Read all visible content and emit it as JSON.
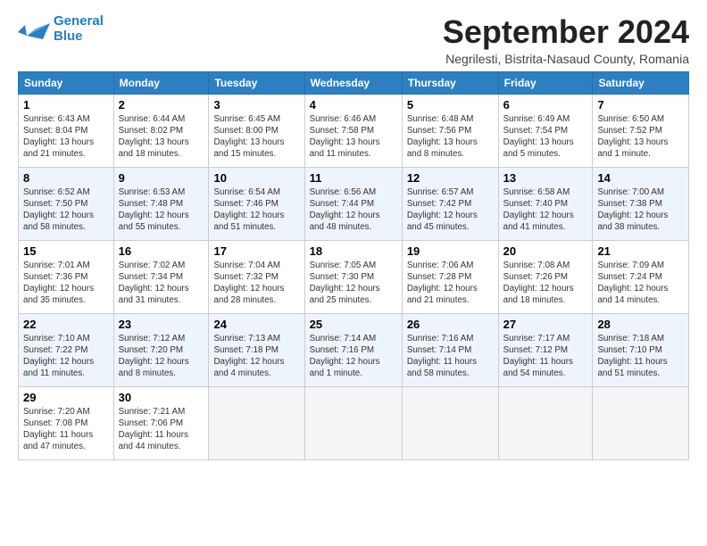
{
  "header": {
    "logo_line1": "General",
    "logo_line2": "Blue",
    "month_title": "September 2024",
    "subtitle": "Negrilesti, Bistrita-Nasaud County, Romania"
  },
  "days_of_week": [
    "Sunday",
    "Monday",
    "Tuesday",
    "Wednesday",
    "Thursday",
    "Friday",
    "Saturday"
  ],
  "weeks": [
    [
      {
        "num": "1",
        "detail": "Sunrise: 6:43 AM\nSunset: 8:04 PM\nDaylight: 13 hours\nand 21 minutes."
      },
      {
        "num": "2",
        "detail": "Sunrise: 6:44 AM\nSunset: 8:02 PM\nDaylight: 13 hours\nand 18 minutes."
      },
      {
        "num": "3",
        "detail": "Sunrise: 6:45 AM\nSunset: 8:00 PM\nDaylight: 13 hours\nand 15 minutes."
      },
      {
        "num": "4",
        "detail": "Sunrise: 6:46 AM\nSunset: 7:58 PM\nDaylight: 13 hours\nand 11 minutes."
      },
      {
        "num": "5",
        "detail": "Sunrise: 6:48 AM\nSunset: 7:56 PM\nDaylight: 13 hours\nand 8 minutes."
      },
      {
        "num": "6",
        "detail": "Sunrise: 6:49 AM\nSunset: 7:54 PM\nDaylight: 13 hours\nand 5 minutes."
      },
      {
        "num": "7",
        "detail": "Sunrise: 6:50 AM\nSunset: 7:52 PM\nDaylight: 13 hours\nand 1 minute."
      }
    ],
    [
      {
        "num": "8",
        "detail": "Sunrise: 6:52 AM\nSunset: 7:50 PM\nDaylight: 12 hours\nand 58 minutes."
      },
      {
        "num": "9",
        "detail": "Sunrise: 6:53 AM\nSunset: 7:48 PM\nDaylight: 12 hours\nand 55 minutes."
      },
      {
        "num": "10",
        "detail": "Sunrise: 6:54 AM\nSunset: 7:46 PM\nDaylight: 12 hours\nand 51 minutes."
      },
      {
        "num": "11",
        "detail": "Sunrise: 6:56 AM\nSunset: 7:44 PM\nDaylight: 12 hours\nand 48 minutes."
      },
      {
        "num": "12",
        "detail": "Sunrise: 6:57 AM\nSunset: 7:42 PM\nDaylight: 12 hours\nand 45 minutes."
      },
      {
        "num": "13",
        "detail": "Sunrise: 6:58 AM\nSunset: 7:40 PM\nDaylight: 12 hours\nand 41 minutes."
      },
      {
        "num": "14",
        "detail": "Sunrise: 7:00 AM\nSunset: 7:38 PM\nDaylight: 12 hours\nand 38 minutes."
      }
    ],
    [
      {
        "num": "15",
        "detail": "Sunrise: 7:01 AM\nSunset: 7:36 PM\nDaylight: 12 hours\nand 35 minutes."
      },
      {
        "num": "16",
        "detail": "Sunrise: 7:02 AM\nSunset: 7:34 PM\nDaylight: 12 hours\nand 31 minutes."
      },
      {
        "num": "17",
        "detail": "Sunrise: 7:04 AM\nSunset: 7:32 PM\nDaylight: 12 hours\nand 28 minutes."
      },
      {
        "num": "18",
        "detail": "Sunrise: 7:05 AM\nSunset: 7:30 PM\nDaylight: 12 hours\nand 25 minutes."
      },
      {
        "num": "19",
        "detail": "Sunrise: 7:06 AM\nSunset: 7:28 PM\nDaylight: 12 hours\nand 21 minutes."
      },
      {
        "num": "20",
        "detail": "Sunrise: 7:08 AM\nSunset: 7:26 PM\nDaylight: 12 hours\nand 18 minutes."
      },
      {
        "num": "21",
        "detail": "Sunrise: 7:09 AM\nSunset: 7:24 PM\nDaylight: 12 hours\nand 14 minutes."
      }
    ],
    [
      {
        "num": "22",
        "detail": "Sunrise: 7:10 AM\nSunset: 7:22 PM\nDaylight: 12 hours\nand 11 minutes."
      },
      {
        "num": "23",
        "detail": "Sunrise: 7:12 AM\nSunset: 7:20 PM\nDaylight: 12 hours\nand 8 minutes."
      },
      {
        "num": "24",
        "detail": "Sunrise: 7:13 AM\nSunset: 7:18 PM\nDaylight: 12 hours\nand 4 minutes."
      },
      {
        "num": "25",
        "detail": "Sunrise: 7:14 AM\nSunset: 7:16 PM\nDaylight: 12 hours\nand 1 minute."
      },
      {
        "num": "26",
        "detail": "Sunrise: 7:16 AM\nSunset: 7:14 PM\nDaylight: 11 hours\nand 58 minutes."
      },
      {
        "num": "27",
        "detail": "Sunrise: 7:17 AM\nSunset: 7:12 PM\nDaylight: 11 hours\nand 54 minutes."
      },
      {
        "num": "28",
        "detail": "Sunrise: 7:18 AM\nSunset: 7:10 PM\nDaylight: 11 hours\nand 51 minutes."
      }
    ],
    [
      {
        "num": "29",
        "detail": "Sunrise: 7:20 AM\nSunset: 7:08 PM\nDaylight: 11 hours\nand 47 minutes."
      },
      {
        "num": "30",
        "detail": "Sunrise: 7:21 AM\nSunset: 7:06 PM\nDaylight: 11 hours\nand 44 minutes."
      },
      {
        "num": "",
        "detail": ""
      },
      {
        "num": "",
        "detail": ""
      },
      {
        "num": "",
        "detail": ""
      },
      {
        "num": "",
        "detail": ""
      },
      {
        "num": "",
        "detail": ""
      }
    ]
  ]
}
